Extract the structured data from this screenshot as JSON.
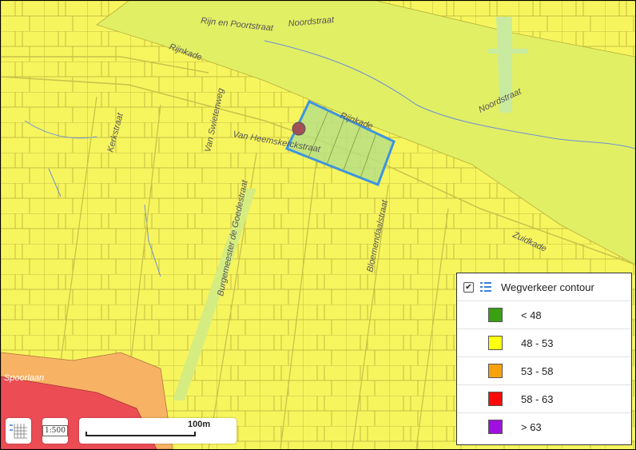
{
  "map": {
    "street_labels": [
      "Rijn en Poortstraat",
      "Noordstraat",
      "Rijnkade",
      "Rijnkade",
      "Noordstraat",
      "Kerkstraat",
      "Van Heemskerckstraat",
      "Van Swietenweg",
      "Burgemeester de Goedestraat",
      "Bloemendaalstraat",
      "Zuidkade",
      "Spoorlaan"
    ],
    "colors": {
      "zone_48_53": "#f7f55e",
      "river": "#e1ef64",
      "parcel_lines": "#b6b03a",
      "parcel_highlight": "#b9df82",
      "parcel_outline": "#3d94e0",
      "marker": "#a15058",
      "zone_53_58": "#f7b264",
      "zone_58_63": "#ec4d55"
    }
  },
  "legend": {
    "checked_mark": "✔",
    "title": "Wegverkeer contour",
    "items": [
      {
        "color": "#3aa010",
        "label": "< 48"
      },
      {
        "color": "#ffff10",
        "label": "48 - 53"
      },
      {
        "color": "#f8a30c",
        "label": "53 - 58"
      },
      {
        "color": "#ff0a0a",
        "label": "58 - 63"
      },
      {
        "color": "#a010e0",
        "label": "> 63"
      }
    ]
  },
  "controls": {
    "scale_text": "100m",
    "scale_button_label": "1:500"
  }
}
